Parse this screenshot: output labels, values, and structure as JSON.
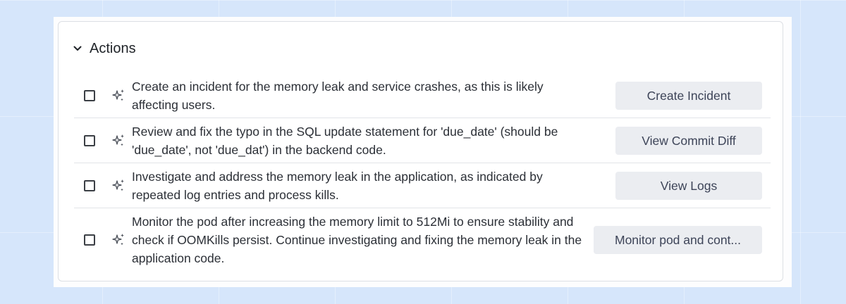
{
  "section": {
    "title": "Actions",
    "icon": "chevron-down-icon"
  },
  "actions": [
    {
      "text": "Create an incident for the memory leak and service crashes, as this is likely affecting users.",
      "button": "Create Incident",
      "checked": false
    },
    {
      "text": "Review and fix the typo in the SQL update statement for 'due_date' (should be 'due_date', not 'due_dat') in the backend code.",
      "button": "View Commit Diff",
      "checked": false
    },
    {
      "text": "Investigate and address the memory leak in the application, as indicated by repeated log entries and process kills.",
      "button": "View Logs",
      "checked": false
    },
    {
      "text": "Monitor the pod after increasing the memory limit to 512Mi to ensure stability and check if OOMKills persist. Continue investigating and fixing the memory leak in the application code.",
      "button": "Monitor pod and cont...",
      "checked": false
    }
  ],
  "colors": {
    "background": "#d6e6fb",
    "button_bg": "#ebedf1",
    "button_text": "#3d4458"
  }
}
